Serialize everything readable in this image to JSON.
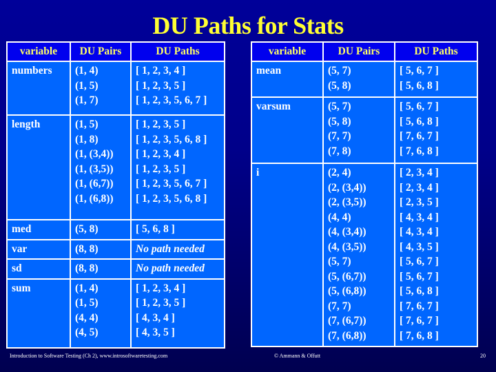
{
  "slide": {
    "title": "DU Paths for Stats",
    "page_number": "20"
  },
  "headers": {
    "variable": "variable",
    "du_pairs": "DU Pairs",
    "du_paths": "DU Paths"
  },
  "left_table": [
    {
      "variable": "numbers",
      "pairs": [
        "(1, 4)",
        "(1, 5)",
        "(1, 7)"
      ],
      "paths": [
        "[ 1, 2, 3, 4 ]",
        "[ 1, 2, 3, 5 ]",
        "[ 1, 2, 3, 5, 6, 7 ]"
      ]
    },
    {
      "variable": "length",
      "pairs": [
        "(1, 5)",
        "(1, 8)",
        "(1, (3,4))",
        "(1, (3,5))",
        "(1, (6,7))",
        "(1, (6,8))"
      ],
      "paths": [
        "[ 1, 2, 3, 5 ]",
        "[ 1, 2, 3, 5, 6, 8 ]",
        "[ 1, 2, 3, 4 ]",
        "[ 1, 2, 3, 5 ]",
        "[ 1, 2, 3, 5, 6, 7 ]",
        "[ 1, 2, 3, 5, 6, 8 ]"
      ]
    },
    {
      "variable": "med",
      "pairs": [
        "(5, 8)"
      ],
      "paths": [
        "[ 5, 6, 8 ]"
      ]
    },
    {
      "variable": "var",
      "pairs": [
        "(8, 8)"
      ],
      "paths": [
        "No path needed"
      ],
      "no_path": true
    },
    {
      "variable": "sd",
      "pairs": [
        "(8, 8)"
      ],
      "paths": [
        "No path needed"
      ],
      "no_path": true
    },
    {
      "variable": "sum",
      "pairs": [
        "(1, 4)",
        "(1, 5)",
        "(4, 4)",
        "(4, 5)"
      ],
      "paths": [
        "[ 1, 2, 3, 4 ]",
        "[ 1, 2, 3, 5 ]",
        "[ 4, 3, 4 ]",
        "[ 4, 3, 5 ]"
      ]
    }
  ],
  "right_table": [
    {
      "variable": "mean",
      "pairs": [
        "(5, 7)",
        "(5, 8)"
      ],
      "paths": [
        "[ 5, 6, 7 ]",
        "[ 5, 6, 8 ]"
      ]
    },
    {
      "variable": "varsum",
      "pairs": [
        "(5, 7)",
        "(5, 8)",
        "(7, 7)",
        "(7, 8)"
      ],
      "paths": [
        "[ 5, 6, 7 ]",
        "[ 5, 6, 8 ]",
        "[ 7, 6, 7 ]",
        "[ 7, 6, 8 ]"
      ]
    },
    {
      "variable": "i",
      "pairs": [
        "(2, 4)",
        "(2, (3,4))",
        "(2, (3,5))",
        "(4, 4)",
        "(4, (3,4))",
        "(4, (3,5))",
        "(5, 7)",
        "(5, (6,7))",
        "(5, (6,8))",
        "(7, 7)",
        "(7, (6,7))",
        "(7, (6,8))"
      ],
      "paths": [
        "[ 2, 3, 4 ]",
        "[ 2, 3, 4 ]",
        "[ 2, 3, 5 ]",
        "[ 4, 3, 4 ]",
        "[ 4, 3, 4 ]",
        "[ 4, 3, 5 ]",
        "[ 5, 6, 7 ]",
        "[ 5, 6, 7 ]",
        "[ 5, 6, 8 ]",
        "[ 7, 6, 7 ]",
        "[ 7, 6, 7 ]",
        "[ 7, 6, 8 ]"
      ]
    }
  ],
  "footer": {
    "left": "Introduction to Software Testing (Ch 2), www.introsoftwaretesting.com",
    "center": "© Ammann & Offutt",
    "right": "20"
  },
  "colors": {
    "background": "#000088",
    "title": "#ffff33",
    "header_cell": "#0000ee",
    "header_text": "#ffff66",
    "body_cell": "#0066ff",
    "border": "#ffffff"
  }
}
